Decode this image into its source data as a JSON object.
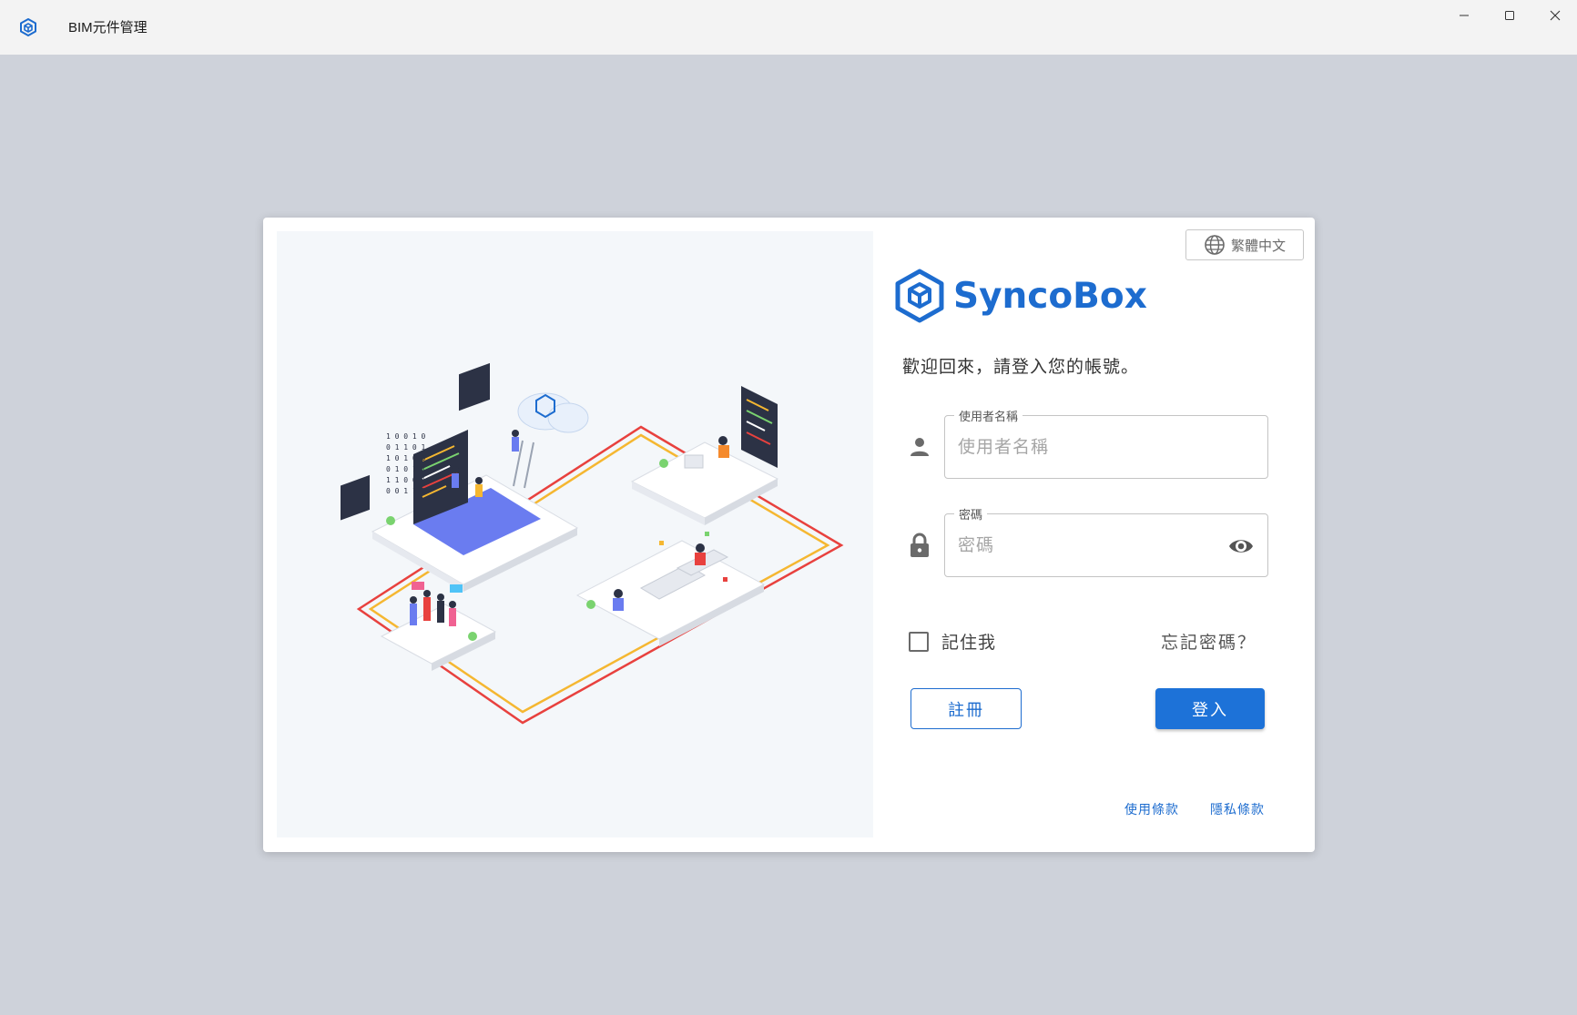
{
  "window": {
    "title": "BIM元件管理",
    "icon": "cube-logo-icon",
    "controls": [
      "minimize-icon",
      "maximize-icon",
      "close-icon"
    ]
  },
  "language": {
    "label": "繁體中文",
    "icon": "globe-icon"
  },
  "brand": {
    "name": "SyncoBox",
    "color": "#1d6ccf"
  },
  "login": {
    "welcome": "歡迎回來，請登入您的帳號。",
    "username": {
      "label": "使用者名稱",
      "placeholder": "使用者名稱",
      "value": "",
      "icon": "person-icon"
    },
    "password": {
      "label": "密碼",
      "placeholder": "密碼",
      "value": "",
      "icon": "lock-icon",
      "toggle_icon": "eye-icon"
    },
    "remember_me": {
      "label": "記住我",
      "checked": false
    },
    "forgot_password": "忘記密碼？",
    "register_button": "註冊",
    "login_button": "登入"
  },
  "footer": {
    "terms": "使用條款",
    "privacy": "隱私條款"
  },
  "colors": {
    "accent": "#1d72d8",
    "background": "#ced2da",
    "panel": "#f4f7fa"
  }
}
